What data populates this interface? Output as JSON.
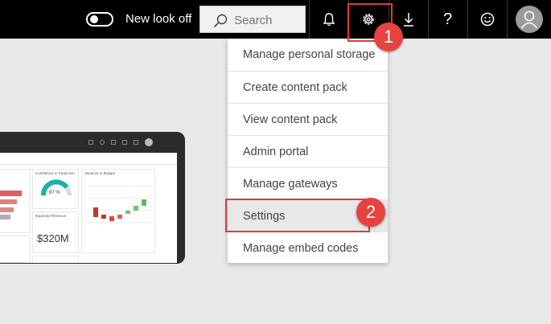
{
  "topbar": {
    "new_look_label": "New look off",
    "search_placeholder": "Search",
    "help_glyph": "?",
    "icons": [
      "toggle-switch",
      "search-icon",
      "bell-icon",
      "gear-icon",
      "download-icon",
      "help-icon",
      "smiley-icon",
      "user-avatar-icon"
    ]
  },
  "callouts": {
    "one": "1",
    "two": "2"
  },
  "menu": {
    "items": [
      {
        "label": "Manage personal storage"
      },
      {
        "label": "Create content pack"
      },
      {
        "label": "View content pack"
      },
      {
        "label": "Admin portal"
      },
      {
        "label": "Manage gateways"
      },
      {
        "label": "Settings"
      },
      {
        "label": "Manage embed codes"
      }
    ]
  },
  "thumbnail": {
    "tile_confidence": "Confidence in Prediction",
    "gauge_value": "87 %",
    "tile_variance": "Variance to Budget",
    "tile_expected": "Expected Revenue",
    "expected_value": "$320M"
  },
  "colors": {
    "topbar": "#000000",
    "highlight": "#e03a3a",
    "badge": "#e8423f",
    "gauge": "#1ab3a6",
    "bar_red": "#e35d5d"
  }
}
